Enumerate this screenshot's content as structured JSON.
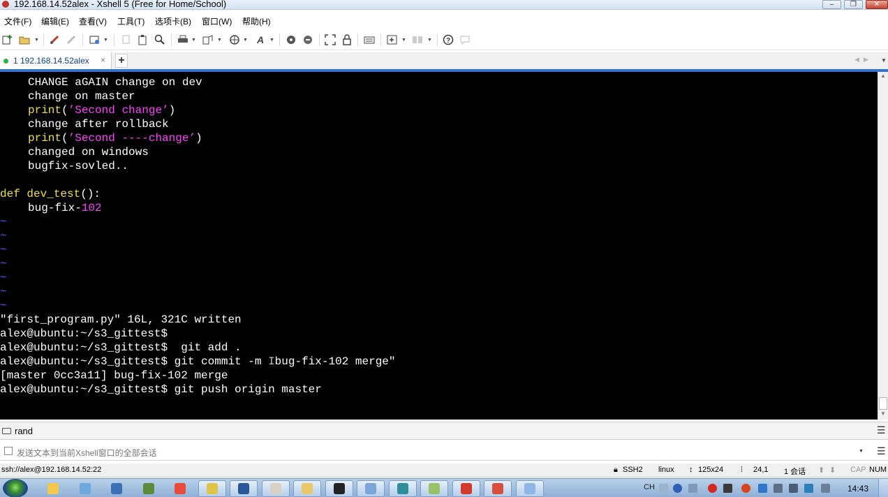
{
  "window": {
    "title": "192.168.14.52alex - Xshell 5 (Free for Home/School)"
  },
  "menu": [
    "文件(F)",
    "编辑(E)",
    "查看(V)",
    "工具(T)",
    "选项卡(B)",
    "窗口(W)",
    "帮助(H)"
  ],
  "toolbar": {
    "icons": [
      "new-session-icon",
      "open-folder-icon",
      "reconnect-icon",
      "disconnect-icon",
      "properties-icon",
      "copy-icon",
      "paste-icon",
      "find-icon",
      "print-icon",
      "transfer-icon",
      "globe-icon",
      "font-icon",
      "xftp-icon",
      "script-icon",
      "fullscreen-icon",
      "lock-icon",
      "keyboard-icon",
      "new-tab-icon",
      "layout-icon",
      "help-icon",
      "chat-icon"
    ]
  },
  "tabs": [
    {
      "label": "1 192.168.14.52alex",
      "close": "×"
    }
  ],
  "tab_add": "+",
  "terminal": {
    "lines": [
      {
        "indent": true,
        "segments": [
          {
            "t": "CHANGE aGAIN change on dev",
            "c": "plain"
          }
        ]
      },
      {
        "indent": true,
        "segments": [
          {
            "t": "change on master",
            "c": "plain"
          }
        ]
      },
      {
        "indent": true,
        "segments": [
          {
            "t": "print",
            "c": "kw"
          },
          {
            "t": "(",
            "c": "punc"
          },
          {
            "t": "’Second change’",
            "c": "str"
          },
          {
            "t": ")",
            "c": "punc"
          }
        ]
      },
      {
        "indent": true,
        "segments": [
          {
            "t": "change after rollback",
            "c": "plain"
          }
        ]
      },
      {
        "indent": true,
        "segments": [
          {
            "t": "print",
            "c": "kw"
          },
          {
            "t": "(",
            "c": "punc"
          },
          {
            "t": "’Second ----change’",
            "c": "str"
          },
          {
            "t": ")",
            "c": "punc"
          }
        ]
      },
      {
        "indent": true,
        "segments": [
          {
            "t": "changed on windows",
            "c": "plain"
          }
        ]
      },
      {
        "indent": true,
        "segments": [
          {
            "t": "bugfix-sovled..",
            "c": "plain"
          }
        ]
      },
      {
        "indent": false,
        "segments": [
          {
            "t": "",
            "c": "plain"
          }
        ]
      },
      {
        "indent": false,
        "segments": [
          {
            "t": "def ",
            "c": "kw"
          },
          {
            "t": "dev_test",
            "c": "fn"
          },
          {
            "t": "():",
            "c": "punc"
          }
        ]
      },
      {
        "indent": true,
        "segments": [
          {
            "t": "bug-fix-",
            "c": "plain"
          },
          {
            "t": "102",
            "c": "num"
          }
        ]
      },
      {
        "indent": false,
        "segments": [
          {
            "t": "~",
            "c": "tilde"
          }
        ]
      },
      {
        "indent": false,
        "segments": [
          {
            "t": "~",
            "c": "tilde"
          }
        ]
      },
      {
        "indent": false,
        "segments": [
          {
            "t": "~",
            "c": "tilde"
          }
        ]
      },
      {
        "indent": false,
        "segments": [
          {
            "t": "~",
            "c": "tilde"
          }
        ]
      },
      {
        "indent": false,
        "segments": [
          {
            "t": "~",
            "c": "tilde"
          }
        ]
      },
      {
        "indent": false,
        "segments": [
          {
            "t": "~",
            "c": "tilde"
          }
        ]
      },
      {
        "indent": false,
        "segments": [
          {
            "t": "~",
            "c": "tilde"
          }
        ]
      },
      {
        "indent": false,
        "segments": [
          {
            "t": "\"first_program.py\" 16L, 321C written",
            "c": "plain"
          }
        ]
      },
      {
        "indent": false,
        "segments": [
          {
            "t": "alex@ubuntu:~/s3_gittest$",
            "c": "plain"
          }
        ]
      },
      {
        "indent": false,
        "segments": [
          {
            "t": "alex@ubuntu:~/s3_gittest$  git add .",
            "c": "plain"
          }
        ]
      },
      {
        "indent": false,
        "segments": [
          {
            "t": "alex@ubuntu:~/s3_gittest$ git commit -m ",
            "c": "plain"
          },
          {
            "t": "I",
            "c": "cursor-mark"
          },
          {
            "t": "bug-fix-102 merge\"",
            "c": "plain"
          }
        ]
      },
      {
        "indent": false,
        "segments": [
          {
            "t": "[master 0cc3a11] bug-fix-102 merge",
            "c": "plain"
          }
        ]
      },
      {
        "indent": false,
        "segments": [
          {
            "t": "alex@ubuntu:~/s3_gittest$ git push origin master",
            "c": "plain"
          }
        ]
      }
    ]
  },
  "quickbar": {
    "label": "rand"
  },
  "compose": {
    "placeholder": "发送文本到当前Xshell窗口的全部会话"
  },
  "status": {
    "connection": "ssh://alex@192.168.14.52:22",
    "protocol": "SSH2",
    "terminal_type": "linux",
    "size": "125x24",
    "position": "24,1",
    "sessions": "1 会话",
    "cap": "CAP",
    "num": "NUM"
  },
  "taskbar": {
    "apps": [
      {
        "name": "chrome-like-taskbar-icon",
        "color": "#f2c94c"
      },
      {
        "name": "tools-taskbar-icon",
        "color": "#6fa8dc"
      },
      {
        "name": "save-taskbar-icon",
        "color": "#3c6fb6"
      },
      {
        "name": "plugin-taskbar-icon",
        "color": "#5b8c3a"
      },
      {
        "name": "chrome-taskbar-icon",
        "color": "#e84a3c"
      },
      {
        "name": "notepad-taskbar-icon",
        "color": "#e0c44a"
      },
      {
        "name": "word-taskbar-icon",
        "color": "#2b579a"
      },
      {
        "name": "app-taskbar-icon",
        "color": "#d9d2c4"
      },
      {
        "name": "explorer-taskbar-icon",
        "color": "#e8c86a"
      },
      {
        "name": "cmd-taskbar-icon",
        "color": "#222222"
      },
      {
        "name": "store-taskbar-icon",
        "color": "#7aa7d8"
      },
      {
        "name": "virtualbox-taskbar-icon",
        "color": "#2e8f9c"
      },
      {
        "name": "git-taskbar-icon",
        "color": "#9bc06a"
      },
      {
        "name": "red-app-taskbar-icon",
        "color": "#d13a2c"
      },
      {
        "name": "xshell-taskbar-icon",
        "color": "#d94e3d"
      },
      {
        "name": "paint-taskbar-icon",
        "color": "#8fb7e6"
      }
    ],
    "tray_lang": "CH",
    "clock": "14:43"
  }
}
